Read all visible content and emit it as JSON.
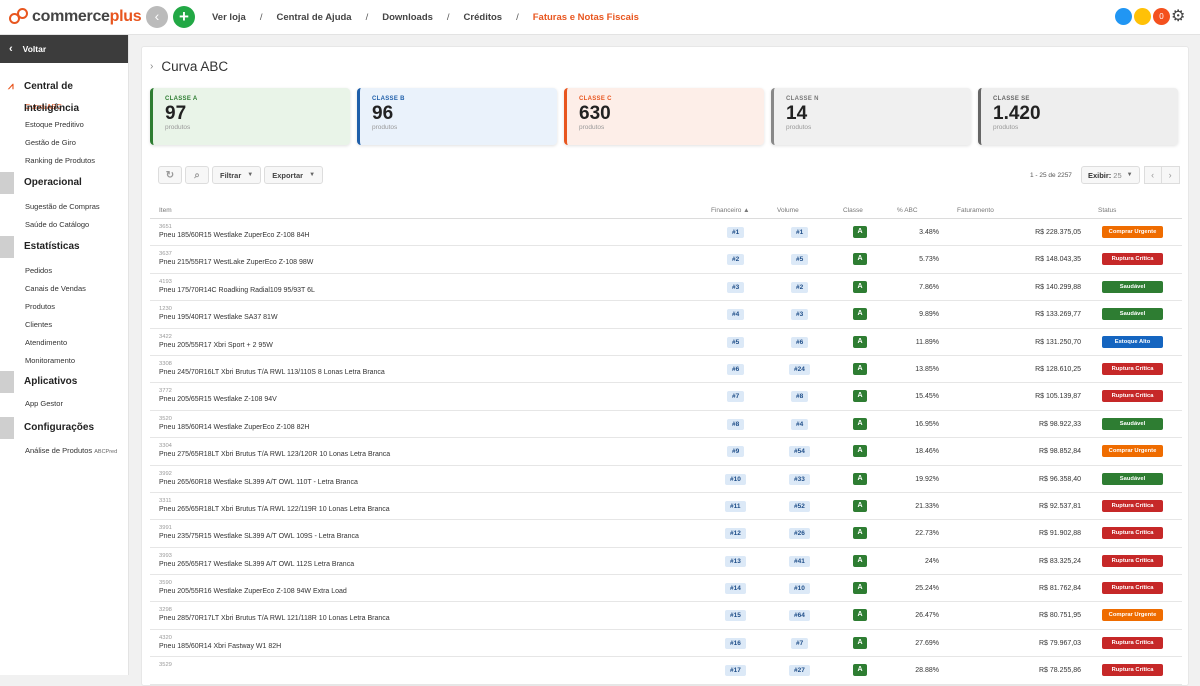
{
  "brand": {
    "name_a": "commerce",
    "name_b": "plus"
  },
  "topnav": {
    "back_icon": "chevron-left-icon",
    "add_label": "+",
    "items": [
      "Ver loja",
      "Central de Ajuda",
      "Downloads",
      "Créditos",
      "Faturas e Notas Fiscais"
    ],
    "separator": "/",
    "status_dots": [
      {
        "color": "#2196f3",
        "label": ""
      },
      {
        "color": "#ffc107",
        "label": ""
      },
      {
        "color": "#f4511e",
        "label": "0"
      }
    ],
    "gear_icon": "gear-icon"
  },
  "sidebar": {
    "back_label": "Voltar",
    "sections": [
      {
        "title": "Central de Inteligência",
        "icon": "chart-line-icon",
        "items": [
          "Curva ABC",
          "Estoque Preditivo",
          "Gestão de Giro",
          "Ranking de Produtos"
        ]
      },
      {
        "title": "Operacional",
        "items": [
          "Sugestão de Compras",
          "Saúde do Catálogo"
        ]
      },
      {
        "title": "Estatísticas",
        "items": [
          "Pedidos",
          "Canais de Vendas",
          "Produtos",
          "Clientes",
          "Atendimento",
          "Monitoramento"
        ]
      },
      {
        "title": "Aplicativos",
        "items": [
          "App Gestor"
        ]
      },
      {
        "title": "Configurações",
        "items": [
          "Análise de Produtos"
        ],
        "badge": "ABCPred"
      }
    ],
    "active_item": "Curva ABC"
  },
  "page": {
    "title": "Curva ABC"
  },
  "cards": [
    {
      "label": "CLASSE A",
      "value": "97",
      "unit": "produtos"
    },
    {
      "label": "CLASSE B",
      "value": "96",
      "unit": "produtos"
    },
    {
      "label": "CLASSE C",
      "value": "630",
      "unit": "produtos"
    },
    {
      "label": "CLASSE N",
      "value": "14",
      "unit": "produtos"
    },
    {
      "label": "CLASSE SE",
      "value": "1.420",
      "unit": "produtos"
    }
  ],
  "toolbar": {
    "refresh_icon": "refresh-icon",
    "search_icon": "search-icon",
    "filter_label": "Filtrar",
    "export_label": "Exportar"
  },
  "pager": {
    "info": "1 - 25 de 2257",
    "show_label": "Exibir:",
    "show_value": "25"
  },
  "table": {
    "headers": {
      "item": "Item",
      "financeiro": "Financeiro ▲",
      "volume": "Volume",
      "classe": "Classe",
      "pct": "% ABC",
      "faturamento": "Faturamento",
      "status": "Status"
    },
    "rows": [
      {
        "code": "3651",
        "name": "Pneu 185/60R15 Westlake ZuperEco Z-108 84H",
        "fin": "#1",
        "vol": "#1",
        "cls": "A",
        "pct": "3.48%",
        "fat": "R$ 228.375,05",
        "status": "Comprar Urgente"
      },
      {
        "code": "3637",
        "name": "Pneu 215/55R17 WestLake ZuperEco Z-108 98W",
        "fin": "#2",
        "vol": "#5",
        "cls": "A",
        "pct": "5.73%",
        "fat": "R$ 148.043,35",
        "status": "Ruptura Crítica"
      },
      {
        "code": "4193",
        "name": "Pneu 175/70R14C Roadking Radial109 95/93T 6L",
        "fin": "#3",
        "vol": "#2",
        "cls": "A",
        "pct": "7.86%",
        "fat": "R$ 140.299,88",
        "status": "Saudável"
      },
      {
        "code": "1230",
        "name": "Pneu 195/40R17 Westlake SA37 81W",
        "fin": "#4",
        "vol": "#3",
        "cls": "A",
        "pct": "9.89%",
        "fat": "R$ 133.269,77",
        "status": "Saudável"
      },
      {
        "code": "3422",
        "name": "Pneu 205/55R17 Xbri Sport + 2 95W",
        "fin": "#5",
        "vol": "#6",
        "cls": "A",
        "pct": "11.89%",
        "fat": "R$ 131.250,70",
        "status": "Estoque Alto"
      },
      {
        "code": "3308",
        "name": "Pneu 245/70R16LT Xbri Brutus T/A RWL 113/110S 8 Lonas Letra Branca",
        "fin": "#6",
        "vol": "#24",
        "cls": "A",
        "pct": "13.85%",
        "fat": "R$ 128.610,25",
        "status": "Ruptura Crítica"
      },
      {
        "code": "3772",
        "name": "Pneu 205/65R15 Westlake Z-108 94V",
        "fin": "#7",
        "vol": "#8",
        "cls": "A",
        "pct": "15.45%",
        "fat": "R$ 105.139,87",
        "status": "Ruptura Crítica"
      },
      {
        "code": "3520",
        "name": "Pneu 185/60R14 Westlake ZuperEco Z-108 82H",
        "fin": "#8",
        "vol": "#4",
        "cls": "A",
        "pct": "16.95%",
        "fat": "R$ 98.922,33",
        "status": "Saudável"
      },
      {
        "code": "3304",
        "name": "Pneu 275/65R18LT Xbri Brutus T/A RWL 123/120R 10 Lonas Letra Branca",
        "fin": "#9",
        "vol": "#54",
        "cls": "A",
        "pct": "18.46%",
        "fat": "R$ 98.852,84",
        "status": "Comprar Urgente"
      },
      {
        "code": "3992",
        "name": "Pneu 265/60R18 Westlake SL399 A/T OWL 110T - Letra Branca",
        "fin": "#10",
        "vol": "#33",
        "cls": "A",
        "pct": "19.92%",
        "fat": "R$ 96.358,40",
        "status": "Saudável"
      },
      {
        "code": "3311",
        "name": "Pneu 265/65R18LT Xbri Brutus T/A RWL 122/119R 10 Lonas Letra Branca",
        "fin": "#11",
        "vol": "#52",
        "cls": "A",
        "pct": "21.33%",
        "fat": "R$ 92.537,81",
        "status": "Ruptura Crítica"
      },
      {
        "code": "3991",
        "name": "Pneu 235/75R15 Westlake SL399 A/T OWL 109S - Letra Branca",
        "fin": "#12",
        "vol": "#26",
        "cls": "A",
        "pct": "22.73%",
        "fat": "R$ 91.902,88",
        "status": "Ruptura Crítica"
      },
      {
        "code": "3993",
        "name": "Pneu 265/65R17 Westlake SL399 A/T OWL 112S Letra Branca",
        "fin": "#13",
        "vol": "#41",
        "cls": "A",
        "pct": "24%",
        "fat": "R$ 83.325,24",
        "status": "Ruptura Crítica"
      },
      {
        "code": "3590",
        "name": "Pneu 205/55R16 Westlake ZuperEco Z-108 94W Extra Load",
        "fin": "#14",
        "vol": "#10",
        "cls": "A",
        "pct": "25.24%",
        "fat": "R$ 81.762,84",
        "status": "Ruptura Crítica"
      },
      {
        "code": "3298",
        "name": "Pneu 285/70R17LT Xbri Brutus T/A RWL 121/118R 10 Lonas Letra Branca",
        "fin": "#15",
        "vol": "#64",
        "cls": "A",
        "pct": "26.47%",
        "fat": "R$ 80.751,95",
        "status": "Comprar Urgente"
      },
      {
        "code": "4320",
        "name": "Pneu 185/60R14 Xbri Fastway W1 82H",
        "fin": "#16",
        "vol": "#7",
        "cls": "A",
        "pct": "27.69%",
        "fat": "R$ 79.967,03",
        "status": "Ruptura Crítica"
      },
      {
        "code": "3529",
        "name": "",
        "fin": "#17",
        "vol": "#27",
        "cls": "A",
        "pct": "28.88%",
        "fat": "R$ 78.255,86",
        "status": "Ruptura Crítica"
      }
    ]
  },
  "status_colors": {
    "Comprar Urgente": "#ef6c00",
    "Ruptura Crítica": "#c62828",
    "Saudável": "#2e7d32",
    "Estoque Alto": "#1565c0"
  }
}
